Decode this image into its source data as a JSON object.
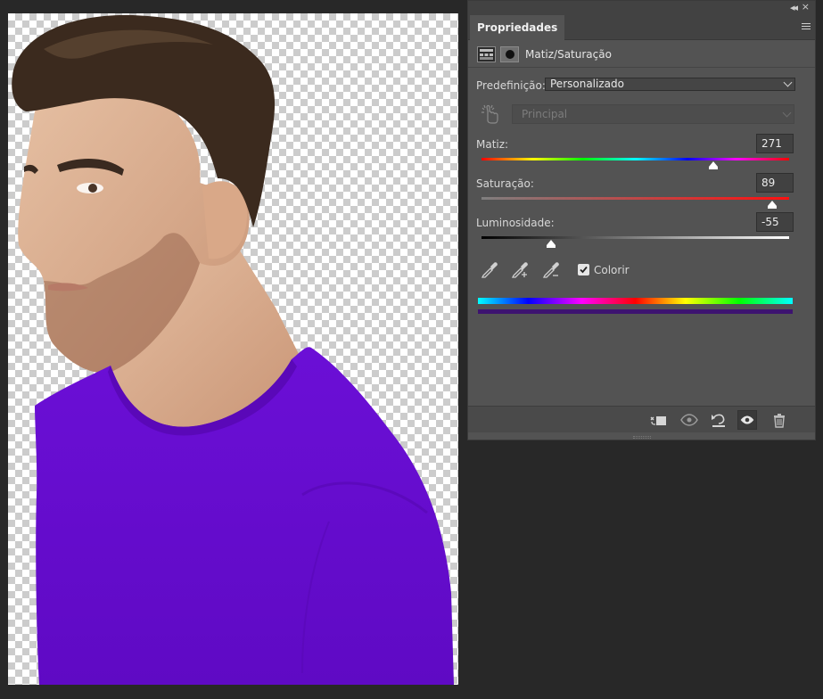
{
  "panel": {
    "tab_label": "Propriedades",
    "adjustment_title": "Matiz/Saturação",
    "preset": {
      "label": "Predefinição:",
      "value": "Personalizado"
    },
    "channel": {
      "value": "Principal"
    },
    "hue": {
      "label": "Matiz:",
      "value": "271",
      "slider_fraction": 0.753
    },
    "saturation": {
      "label": "Saturação:",
      "value": "89",
      "slider_fraction": 0.945
    },
    "lightness": {
      "label": "Luminosidade:",
      "value": "-55",
      "slider_fraction": 0.225
    },
    "colorize": {
      "label": "Colorir",
      "checked": true
    },
    "result_color": "#3d1370"
  },
  "icons": [
    "collapse-icon",
    "close-icon",
    "panel-menu-icon",
    "adjustment-layer-icon",
    "mask-icon",
    "targeted-adjustment-icon",
    "eyedropper-icon",
    "eyedropper-add-icon",
    "eyedropper-subtract-icon",
    "clip-to-layer-icon",
    "view-previous-icon",
    "reset-icon",
    "visibility-icon",
    "trash-icon"
  ],
  "colors": {
    "shirt": "#6a0fd3",
    "panel_bg": "#535353",
    "app_bg": "#282828"
  }
}
